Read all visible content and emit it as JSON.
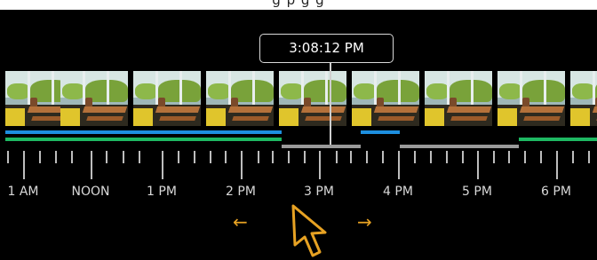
{
  "header": {
    "partial_text": "g  p  g  g"
  },
  "scrubber": {
    "time": "3:08:12 PM"
  },
  "timeline": {
    "hour_labels": [
      "1 AM",
      "NOON",
      "1 PM",
      "2 PM",
      "3 PM",
      "4 PM",
      "5 PM",
      "6 PM"
    ],
    "colors": {
      "blue": "#1d8fe0",
      "green": "#1eb862",
      "gray": "#9a9a9a",
      "tick": "#bdbdbd"
    }
  },
  "controls": {
    "scroll_left_arrow": "←",
    "scroll_right_arrow": "→",
    "accent_color": "#e7a223"
  }
}
